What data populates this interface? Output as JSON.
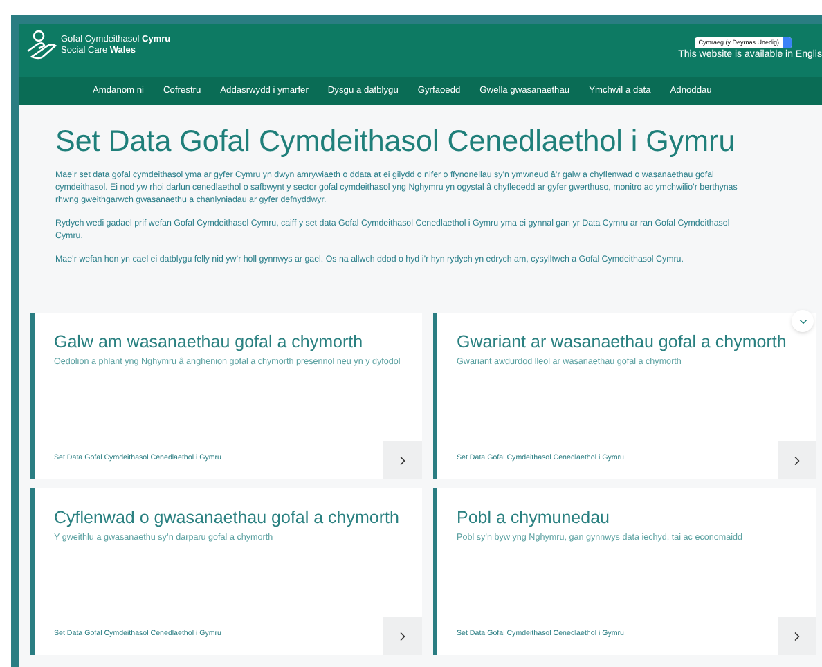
{
  "header": {
    "logo_lines": [
      "Gofal Cymdeithasol **Cymru**",
      "Social Care **Wales**"
    ],
    "language_select": {
      "value": "Cymraeg (y Deyrnas Unedig)"
    },
    "language_notice": "This website is available in Englis"
  },
  "nav": [
    "Amdanom ni",
    "Cofrestru",
    "Addasrwydd i ymarfer",
    "Dysgu a datblygu",
    "Gyrfaoedd",
    "Gwella gwasanaethau",
    "Ymchwil a data",
    "Adnoddau"
  ],
  "page": {
    "title": "Set Data Gofal Cymdeithasol Cenedlaethol i Gymru",
    "paragraphs": [
      "Mae’r set data gofal cymdeithasol yma ar gyfer Cymru yn dwyn amrywiaeth o ddata at ei gilydd o nifer o ffynonellau sy’n ymwneud â’r galw a chyflenwad o wasanaethau gofal cymdeithasol. Ei nod yw rhoi darlun cenedlaethol o safbwynt y sector gofal cymdeithasol yng Nghymru yn ogystal â chyfleoedd ar gyfer gwerthuso, monitro ac ymchwilio’r berthynas rhwng gweithgarwch gwasanaethu a chanlyniadau ar gyfer defnyddwyr.",
      "Rydych wedi gadael prif wefan Gofal Cymdeithasol Cymru, caiff y set data Gofal Cymdeithasol Cenedlaethol i Gymru yma ei gynnal gan yr Data Cymru ar ran Gofal Cymdeithasol Cymru.",
      "Mae’r wefan hon yn cael ei datblygu felly nid yw’r holl gynnwys ar gael. Os na allwch ddod o hyd i’r hyn rydych yn edrych am, cysylltwch a Gofal Cymdeithasol Cymru."
    ]
  },
  "cards": [
    {
      "title": "Galw am wasanaethau gofal a chymorth",
      "description": "Oedolion a phlant yng Nghymru â anghenion gofal a chymorth presennol neu yn y dyfodol",
      "footer": "Set Data Gofal Cymdeithasol Cenedlaethol i Gymru"
    },
    {
      "title": "Gwariant ar wasanaethau gofal a chymorth",
      "description": "Gwariant awdurdod lleol ar wasanaethau gofal a chymorth",
      "footer": "Set Data Gofal Cymdeithasol Cenedlaethol i Gymru"
    },
    {
      "title": "Cyflenwad o gwasanaethau gofal a chymorth",
      "description": "Y gweithlu a gwasanaethu sy’n darparu gofal a chymorth",
      "footer": "Set Data Gofal Cymdeithasol Cenedlaethol i Gymru"
    },
    {
      "title": "Pobl a chymunedau",
      "description": "Pobl sy’n byw yng Nghymru, gan gynnwys data iechyd, tai ac economaidd",
      "footer": "Set Data Gofal Cymdeithasol Cenedlaethol i Gymru"
    }
  ]
}
